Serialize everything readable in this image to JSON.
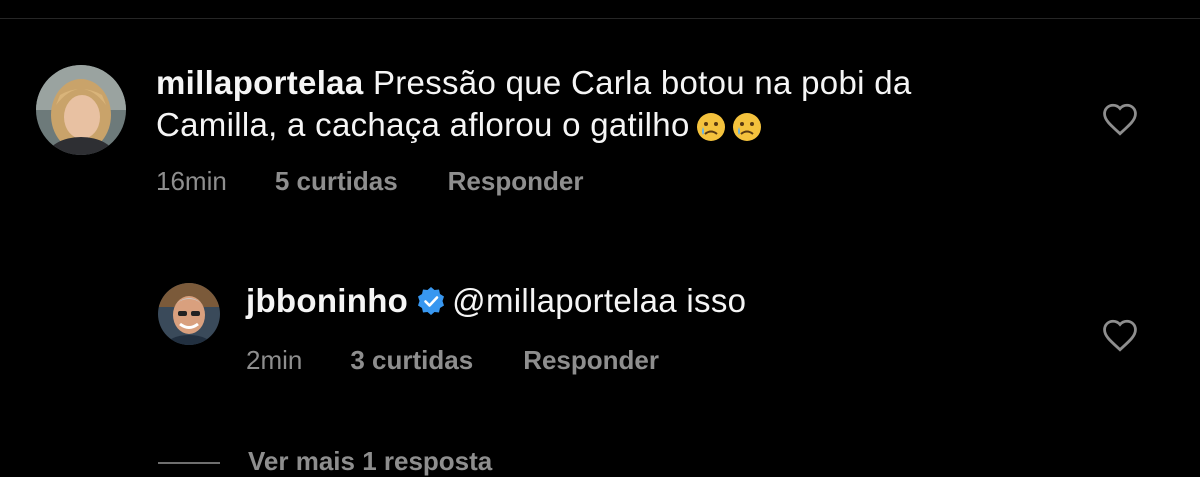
{
  "comment": {
    "username": "millaportelaa",
    "text_line1": "Pressão que Carla botou na pobi da",
    "text_line2": "Camilla, a cachaça aflorou o gatilho",
    "emojis": [
      "crying-face",
      "crying-face"
    ],
    "time": "16min",
    "likes": "5 curtidas",
    "reply_label": "Responder",
    "like_icon": "heart-outline"
  },
  "reply": {
    "username": "jbboninho",
    "verified": true,
    "mention": "@millaportelaa",
    "text": "isso",
    "time": "2min",
    "likes": "3 curtidas",
    "reply_label": "Responder",
    "like_icon": "heart-outline"
  },
  "view_more_replies": "Ver mais 1 resposta",
  "colors": {
    "background": "#000000",
    "text": "#f5f5f5",
    "secondary": "#8e8e8e",
    "verified": "#3897f0"
  }
}
